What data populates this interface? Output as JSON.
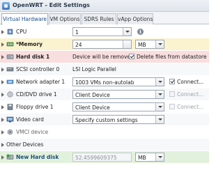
{
  "window": {
    "title": "OpenWRT - Edit Settings"
  },
  "tabs": [
    {
      "label": "Virtual Hardware",
      "active": true
    },
    {
      "label": "VM Options",
      "active": false
    },
    {
      "label": "SDRS Rules",
      "active": false
    },
    {
      "label": "vApp Options",
      "active": false
    }
  ],
  "rows": {
    "cpu": {
      "label": "CPU",
      "value": "1"
    },
    "memory": {
      "label": "*Memory",
      "value": "24",
      "unit": "MB"
    },
    "hard_disk_1": {
      "label": "Hard disk 1",
      "status": "Device will be removed",
      "delete_label": "Delete files from datastore",
      "delete_checked": true
    },
    "scsi": {
      "label": "SCSI controller 0",
      "value": "LSI Logic Parallel"
    },
    "network": {
      "label": "Network adapter 1",
      "value": "1003 VMs non-autolab",
      "connect_label": "Connect...",
      "connect_checked": true
    },
    "cddvd": {
      "label": "CD/DVD drive 1",
      "value": "Client Device",
      "connect_label": "Connect...",
      "connect_checked": false
    },
    "floppy": {
      "label": "Floppy drive 1",
      "value": "Client Device",
      "connect_label": "Connect...",
      "connect_checked": false
    },
    "video": {
      "label": "Video card",
      "value": "Specify custom settings"
    },
    "vmci": {
      "label": "VMCI device"
    },
    "other": {
      "label": "Other Devices"
    },
    "new_disk": {
      "label": "New Hard disk",
      "value": "52.4599609375",
      "unit": "MB"
    }
  },
  "colors": {
    "memory_row": "#fbf3cf",
    "removed_row": "#f8dede",
    "new_row": "#e2f1dc",
    "active_tab_text": "#1a4f8b"
  }
}
